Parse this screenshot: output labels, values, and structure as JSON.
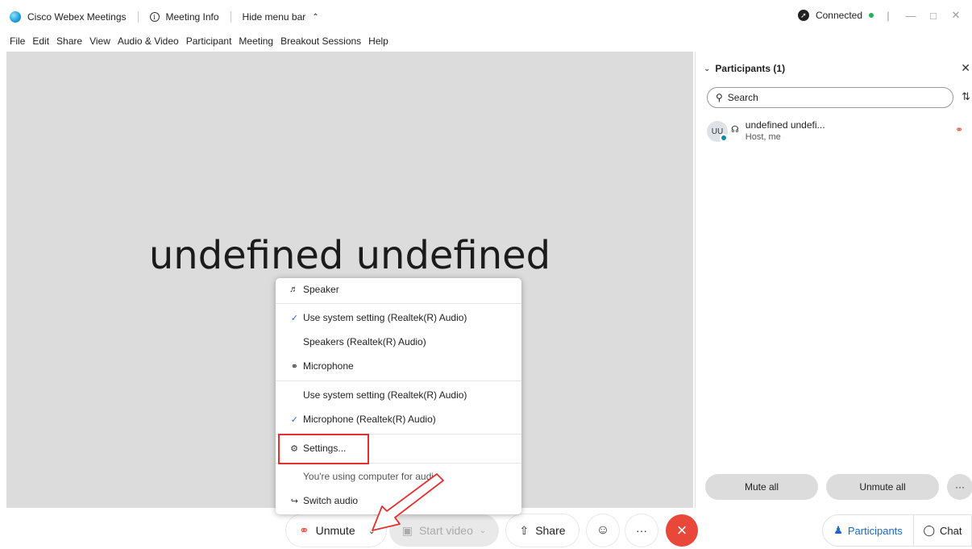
{
  "titlebar": {
    "app_name": "Cisco Webex Meetings",
    "meeting_info": "Meeting Info",
    "hide_menu": "Hide menu bar",
    "connection": "Connected"
  },
  "menubar": [
    "File",
    "Edit",
    "Share",
    "View",
    "Audio & Video",
    "Participant",
    "Meeting",
    "Breakout Sessions",
    "Help"
  ],
  "stage": {
    "name": "undefined undefined"
  },
  "panel": {
    "title": "Participants (1)",
    "search_placeholder": "Search",
    "participants": [
      {
        "initials": "UU",
        "name": "undefined undefi...",
        "role": "Host, me"
      }
    ],
    "mute_all": "Mute all",
    "unmute_all": "Unmute all",
    "more": "···"
  },
  "audio_menu": {
    "speaker_header": "Speaker",
    "speaker_items": [
      "Use system setting (Realtek(R) Audio)",
      "Speakers (Realtek(R) Audio)"
    ],
    "mic_header": "Microphone",
    "mic_items": [
      "Use system setting (Realtek(R) Audio)",
      "Microphone (Realtek(R) Audio)"
    ],
    "settings": "Settings...",
    "status": "You're using computer for audio",
    "switch": "Switch audio"
  },
  "toolbar": {
    "unmute": "Unmute",
    "start_video": "Start video",
    "share": "Share",
    "more": "···",
    "participants": "Participants",
    "chat": "Chat"
  },
  "colors": {
    "accent": "#1a67c7",
    "end_call": "#e8473a",
    "muted": "#e04c33",
    "highlight": "#e23030",
    "connected": "#1fb35a"
  }
}
